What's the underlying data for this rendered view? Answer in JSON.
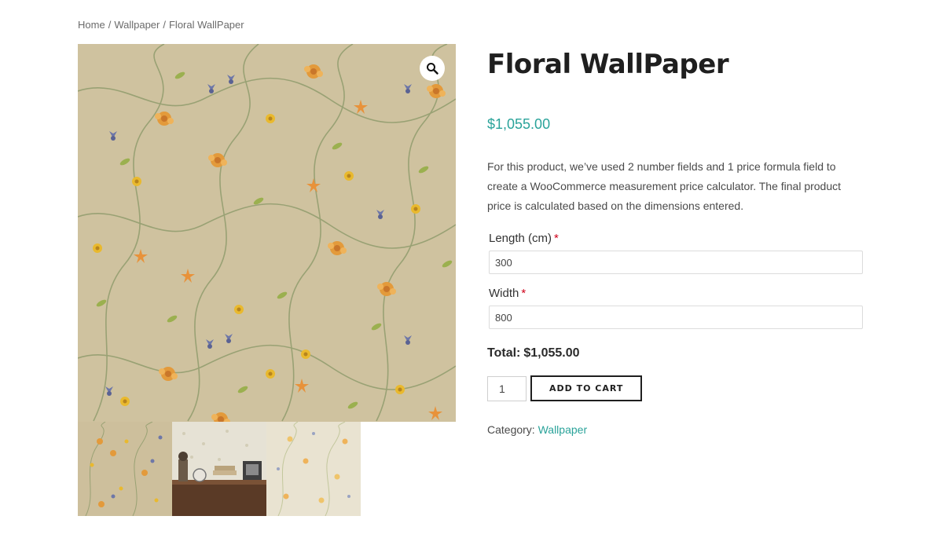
{
  "breadcrumb": {
    "items": [
      "Home",
      "Wallpaper",
      "Floral WallPaper"
    ],
    "separator": "/"
  },
  "gallery": {
    "zoom_icon": "magnifier-icon",
    "thumbnails": [
      "floral-pattern",
      "desk-room-scene",
      "light-floral-pattern"
    ]
  },
  "product": {
    "title": "Floral WallPaper",
    "price": "$1,055.00",
    "description": "For this product, we’ve used 2 number fields and 1 price formula field to create a WooCommerce measurement price calculator. The final product price is calculated based on the dimensions entered."
  },
  "fields": {
    "length": {
      "label": "Length (cm)",
      "required_mark": "*",
      "value": "300"
    },
    "width": {
      "label": "Width",
      "required_mark": "*",
      "value": "800"
    }
  },
  "total": {
    "label": "Total:",
    "value": "$1,055.00"
  },
  "cart": {
    "quantity": "1",
    "button_label": "ADD TO CART"
  },
  "meta": {
    "category_label": "Category:",
    "category_value": "Wallpaper"
  },
  "colors": {
    "accent": "#2aa39a",
    "required": "#d0021b",
    "wallpaper_bg": "#cfc29f"
  }
}
